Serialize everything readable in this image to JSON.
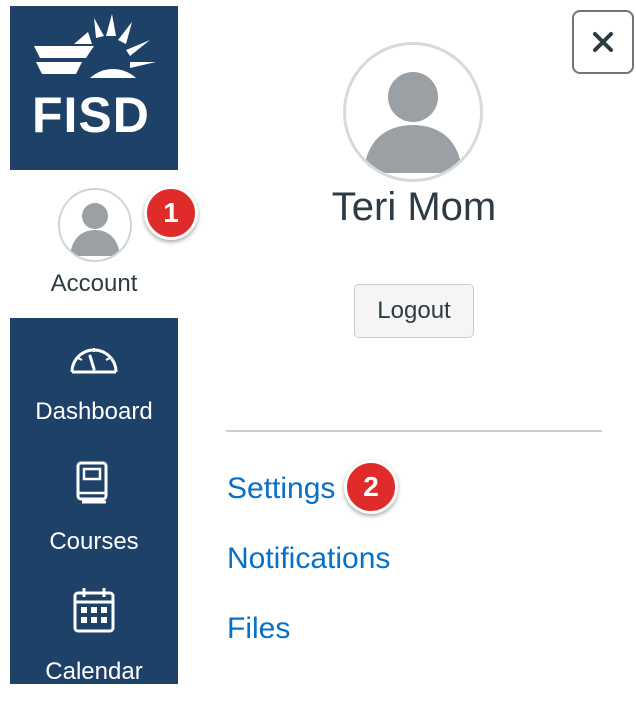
{
  "nav": {
    "logo_text": "FISD",
    "items": [
      {
        "label": "Account",
        "icon": "avatar-icon"
      },
      {
        "label": "Dashboard",
        "icon": "dashboard-icon"
      },
      {
        "label": "Courses",
        "icon": "courses-icon"
      },
      {
        "label": "Calendar",
        "icon": "calendar-icon"
      }
    ]
  },
  "tray": {
    "close_label": "×",
    "user_name": "Teri Mom",
    "logout_label": "Logout",
    "links": [
      "Settings",
      "Notifications",
      "Files"
    ]
  },
  "badges": {
    "step1": "1",
    "step2": "2"
  },
  "colors": {
    "nav_bg": "#1e4168",
    "link": "#0770c8",
    "badge": "#e02b2b",
    "text": "#2d3b45"
  }
}
